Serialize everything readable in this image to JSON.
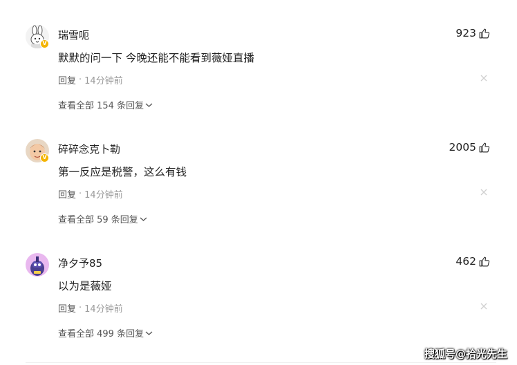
{
  "comments": [
    {
      "username": "瑞雪呃",
      "likes": "923",
      "text": "默默的问一下 今晚还能不能看到薇娅直播",
      "reply_label": "回复",
      "time": "14分钟前",
      "view_all": "查看全部 154 条回复",
      "avatar_icon": "cartoon-bunny-avatar",
      "badge": "V"
    },
    {
      "username": "碎碎念克卜勒",
      "likes": "2005",
      "text": "第一反应是税警，这么有钱",
      "reply_label": "回复",
      "time": "14分钟前",
      "view_all": "查看全部 59 条回复",
      "avatar_icon": "cartoon-face-avatar",
      "badge": "V"
    },
    {
      "username": "净夕予85",
      "likes": "462",
      "text": "以为是薇娅",
      "reply_label": "回复",
      "time": "14分钟前",
      "view_all": "查看全部 499 条回复",
      "avatar_icon": "cartoon-character-avatar"
    }
  ],
  "watermark": "搜狐号@拾光先生",
  "colors": {
    "text": "#222222",
    "muted": "#999999",
    "badge": "#f4b400"
  }
}
